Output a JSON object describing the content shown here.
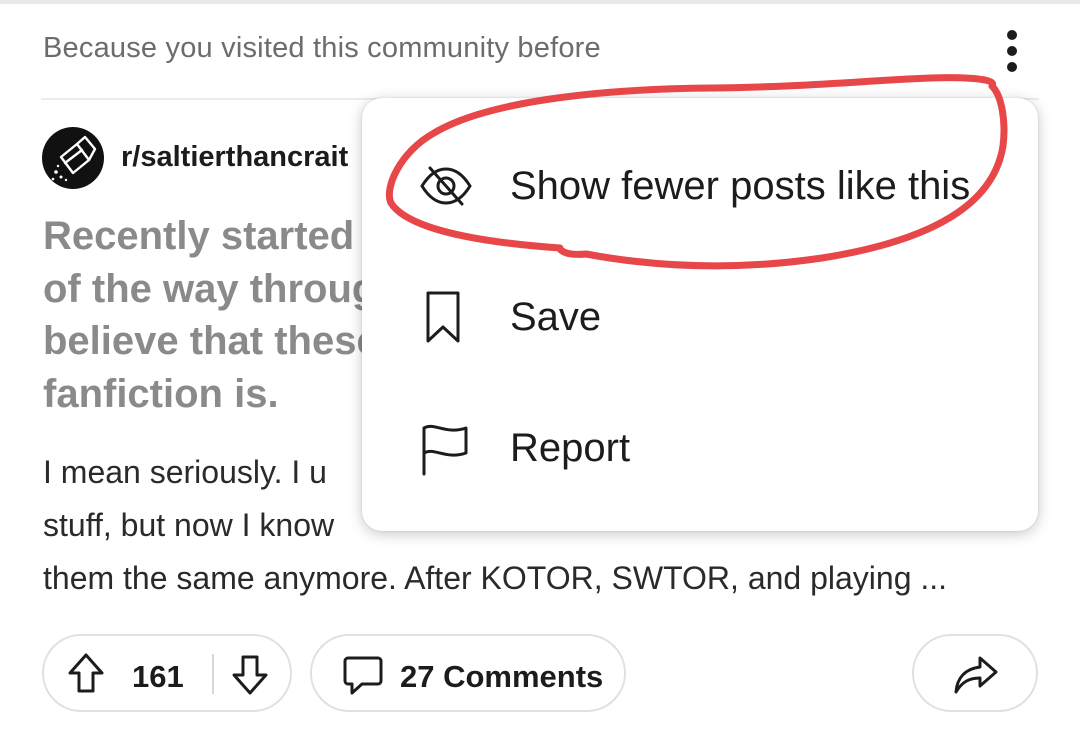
{
  "feed": {
    "recommendation_reason": "Because you visited this community before",
    "more_options_icon": "vertical-ellipsis-icon"
  },
  "post": {
    "subreddit": "r/saltierthancrait",
    "avatar_icon": "salt-shaker-icon",
    "title_lines": [
      "Recently started",
      "of the way throug",
      "believe that these",
      "fanfiction is."
    ],
    "body_lines": [
      "I mean seriously. I u",
      "stuff, but now I know",
      "them the same anymore. After KOTOR, SWTOR, and playing ..."
    ],
    "actions": {
      "upvote_icon": "upvote-arrow-icon",
      "vote_count": "161",
      "downvote_icon": "downvote-arrow-icon",
      "comments_icon": "comment-bubble-icon",
      "comments_label": "27 Comments",
      "share_icon": "share-arrow-icon"
    }
  },
  "overflow_menu": {
    "items": [
      {
        "label": "Show fewer posts like this",
        "icon": "eye-off-icon"
      },
      {
        "label": "Save",
        "icon": "bookmark-icon"
      },
      {
        "label": "Report",
        "icon": "flag-icon"
      }
    ]
  },
  "annotation": {
    "type": "hand-drawn red ellipse",
    "highlights": "Show fewer posts like this",
    "color": "#e8474a"
  },
  "colors": {
    "text_primary": "#1c1c1c",
    "text_secondary": "#6c6c6c",
    "title_muted": "#8a8a8a",
    "annotation_red": "#e8474a"
  }
}
